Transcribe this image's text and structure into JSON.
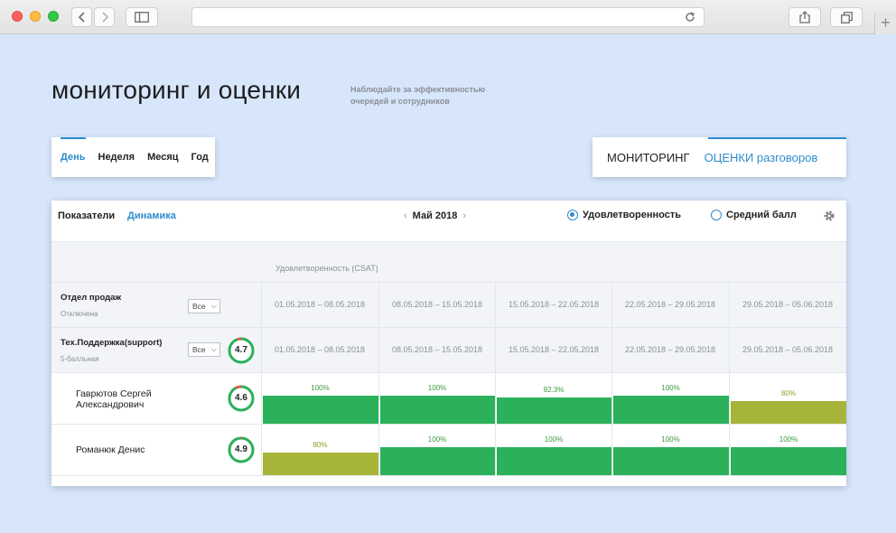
{
  "colors": {
    "accent": "#2f8ccd",
    "bar_green": "#2bb15a",
    "bar_olive": "#a6b53a",
    "pct_green": "#3d9a3d",
    "pct_olive": "#8ba32a"
  },
  "header": {
    "title": "мониторинг и оценки",
    "subtitle_line1": "Наблюдайте за эффективностью",
    "subtitle_line2": "очередей и сотрудников"
  },
  "period_tabs": [
    {
      "label": "День",
      "active": true
    },
    {
      "label": "Неделя",
      "active": false
    },
    {
      "label": "Месяц",
      "active": false
    },
    {
      "label": "Год",
      "active": false
    }
  ],
  "mode_tabs": {
    "monitoring": "МОНИТОРИНГ",
    "ratings": "ОЦЕНКИ разговоров"
  },
  "toolbar": {
    "indicators": "Показатели",
    "dynamics": "Динамика",
    "month": "Май 2018",
    "prev_icon": "‹",
    "next_icon": "›",
    "radio_satisfaction": "Удовлетворенность",
    "radio_average": "Средний балл",
    "radio_selected": "satisfaction"
  },
  "table": {
    "metric_label": "Удовлетворенность (CSAT)",
    "periods": [
      "01.05.2018 – 08.05.2018",
      "08.05.2018 – 15.05.2018",
      "15.05.2018 – 22.05.2018",
      "22.05.2018 – 29.05.2018",
      "29.05.2018 – 05.06.2018"
    ],
    "departments": [
      {
        "name": "Отдел продаж",
        "sub": "Отключена",
        "filter": "Все"
      },
      {
        "name": "Тех.Поддержка(support)",
        "sub": "5-балльная",
        "filter": "Все",
        "score": "4.7",
        "score_value": 4.7
      }
    ],
    "employees": [
      {
        "name_line1": "Гаврютов Сергей",
        "name_line2": "Александрович",
        "score": "4.6",
        "score_value": 4.6,
        "values": [
          {
            "label": "100%",
            "value": 100,
            "tone": "green"
          },
          {
            "label": "100%",
            "value": 100,
            "tone": "green"
          },
          {
            "label": "92.3%",
            "value": 92.3,
            "tone": "green"
          },
          {
            "label": "100%",
            "value": 100,
            "tone": "green"
          },
          {
            "label": "80%",
            "value": 80,
            "tone": "olive"
          }
        ]
      },
      {
        "name_line1": "Романюк Денис",
        "name_line2": "",
        "score": "4.9",
        "score_value": 4.9,
        "values": [
          {
            "label": "80%",
            "value": 80,
            "tone": "olive"
          },
          {
            "label": "100%",
            "value": 100,
            "tone": "green"
          },
          {
            "label": "100%",
            "value": 100,
            "tone": "green"
          },
          {
            "label": "100%",
            "value": 100,
            "tone": "green"
          },
          {
            "label": "100%",
            "value": 100,
            "tone": "green"
          }
        ]
      }
    ]
  }
}
